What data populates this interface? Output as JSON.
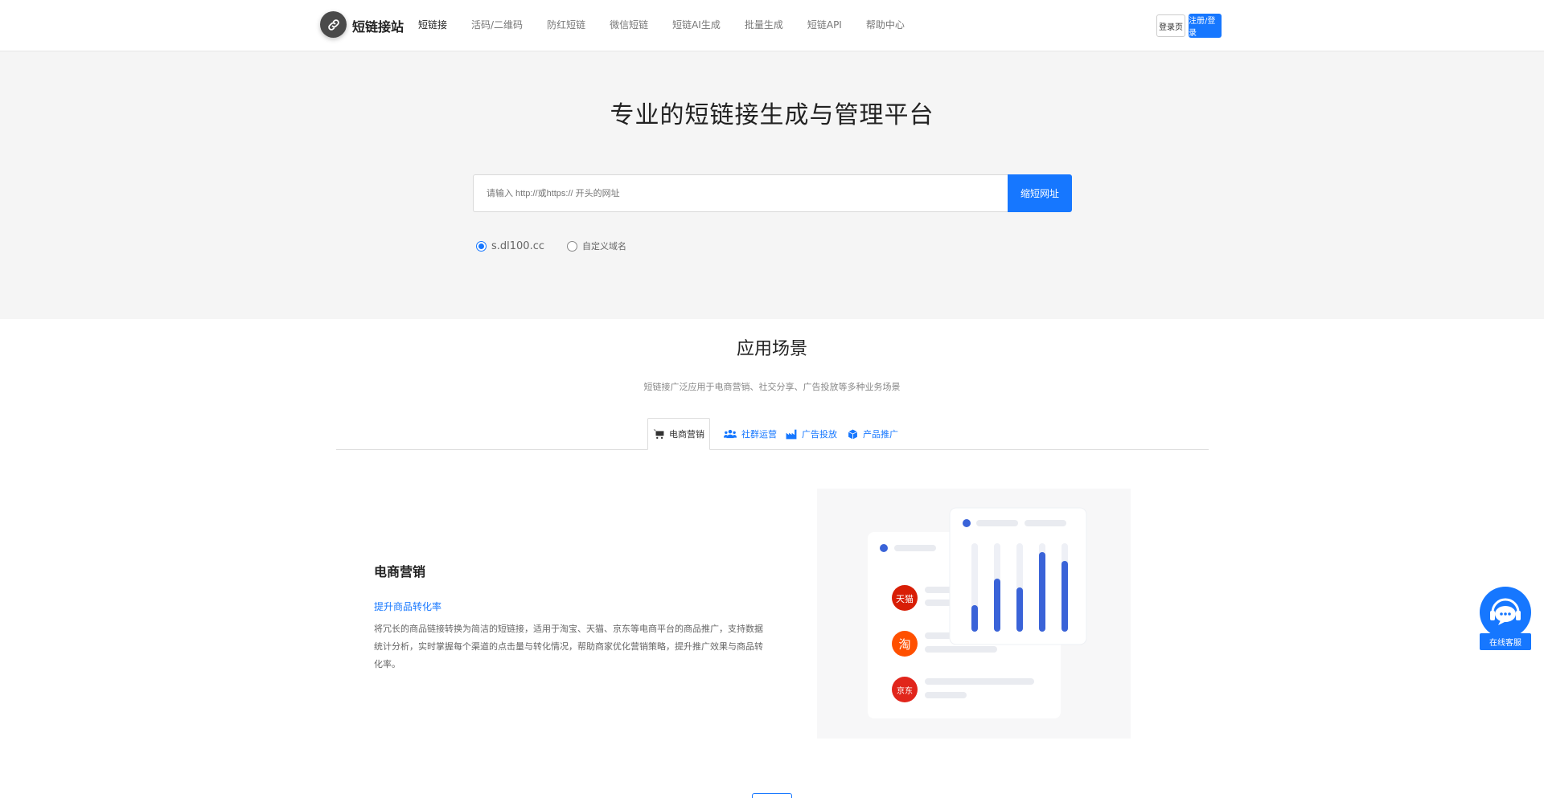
{
  "header": {
    "logo_text": "短链接站",
    "nav": [
      "短链接",
      "活码/二维码",
      "防红短链",
      "微信短链",
      "短链AI生成",
      "批量生成",
      "短链API",
      "帮助中心"
    ],
    "login_label": "登录页",
    "register_label": "注册/登录"
  },
  "hero": {
    "title": "专业的短链接生成与管理平台",
    "search_placeholder": "请输入 http://或https:// 开头的网址",
    "search_button": "缩短网址",
    "domains": [
      "s.dl100.cc",
      "自定义域名"
    ]
  },
  "scenes": {
    "title": "应用场景",
    "subtitle": "短链接广泛应用于电商营销、社交分享、广告投放等多种业务场景",
    "tabs": [
      {
        "label": "电商营销",
        "icon": "cart-icon"
      },
      {
        "label": "社群运营",
        "icon": "users-icon"
      },
      {
        "label": "广告投放",
        "icon": "factory-icon"
      },
      {
        "label": "产品推广",
        "icon": "cube-icon"
      }
    ],
    "active_tab": "电商营销",
    "card": {
      "title": "电商营销",
      "subtitle": "提升商品转化率",
      "description": "将冗长的商品链接转换为简洁的短链接，适用于淘宝、天猫、京东等电商平台的商品推广，支持数据统计分析，实时掌握每个渠道的点击量与转化情况，帮助商家优化营销策略，提升推广效果与商品转化率。"
    },
    "illustration": {
      "platforms": [
        {
          "name": "天猫",
          "color": "#d81e06"
        },
        {
          "name": "淘",
          "color": "#ff5000"
        },
        {
          "name": "京东",
          "color": "#e1251b"
        }
      ],
      "bars": [
        0.3,
        0.6,
        0.5,
        0.9,
        0.8
      ],
      "accent": "#3a63d8"
    }
  },
  "support": {
    "label": "在线客服"
  },
  "colors": {
    "primary": "#1677ff",
    "hero_bg": "#f5f5f5"
  }
}
